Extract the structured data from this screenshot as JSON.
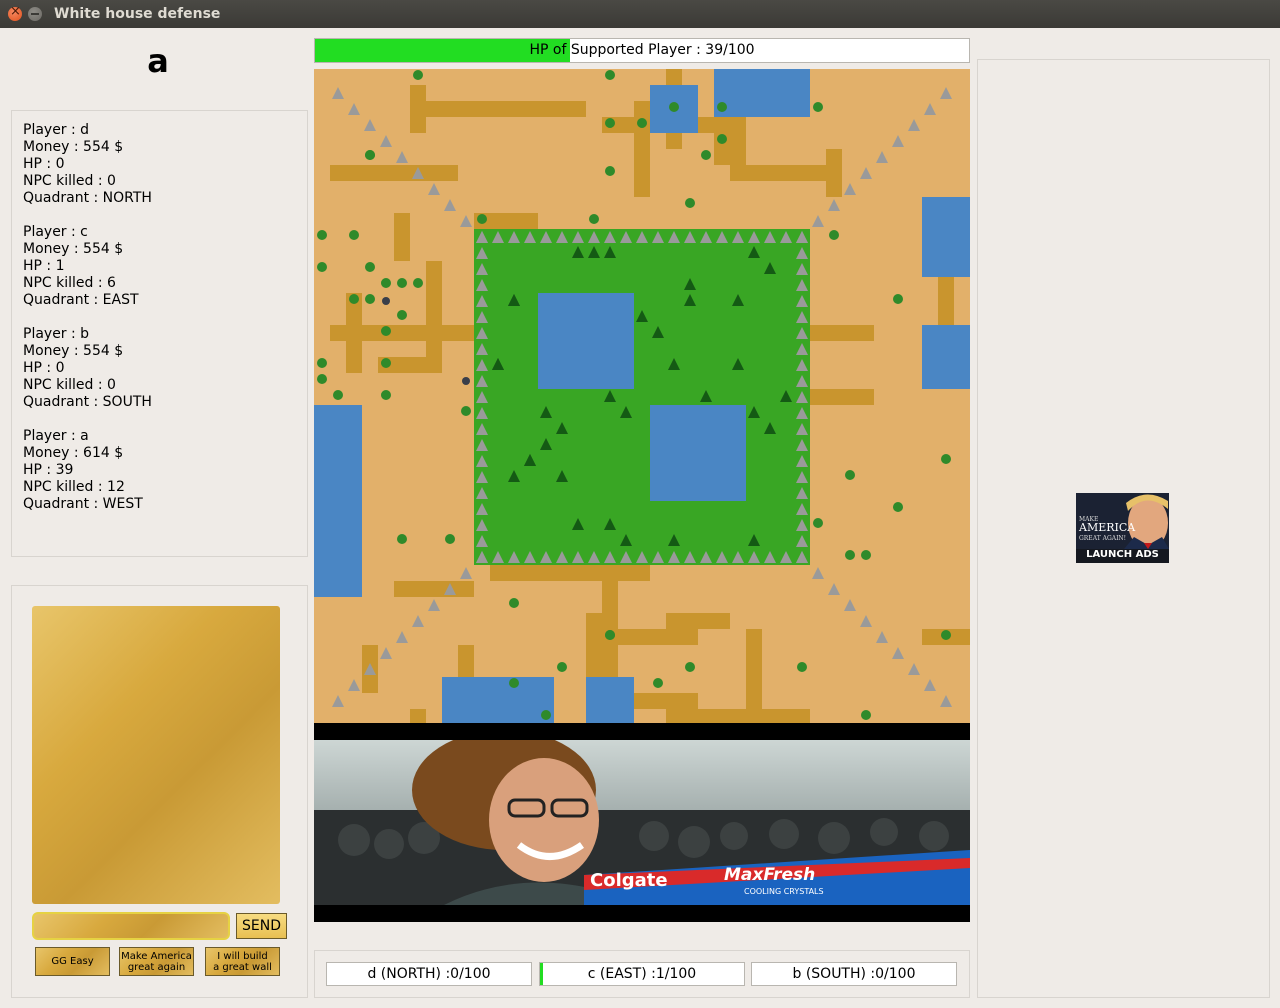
{
  "window": {
    "title": "White house defense"
  },
  "player": {
    "name": "a"
  },
  "players": [
    {
      "player": "Player : d",
      "money": "Money : 554 $",
      "hp": "HP : 0",
      "npc": "NPC killed : 0",
      "quadrant": "Quadrant : NORTH"
    },
    {
      "player": "Player : c",
      "money": "Money : 554 $",
      "hp": "HP : 1",
      "npc": "NPC killed : 6",
      "quadrant": "Quadrant : EAST"
    },
    {
      "player": "Player : b",
      "money": "Money : 554 $",
      "hp": "HP : 0",
      "npc": "NPC killed : 0",
      "quadrant": "Quadrant : SOUTH"
    },
    {
      "player": "Player : a",
      "money": "Money : 614 $",
      "hp": "HP : 39",
      "npc": "NPC killed : 12",
      "quadrant": "Quadrant : WEST"
    }
  ],
  "hp_bar": {
    "label": "HP of Supported Player : 39/100",
    "value": 39,
    "max": 100,
    "color": "#22dd22"
  },
  "chat": {
    "input_value": "",
    "send_label": "SEND",
    "quick_messages": [
      {
        "line1": "GG Easy",
        "line2": ""
      },
      {
        "line1": "Make America",
        "line2": "great again"
      },
      {
        "line1": "I will build",
        "line2": "a great wall"
      }
    ]
  },
  "ad": {
    "small1": "MAKE",
    "big": "AMERICA",
    "small2": "GREAT AGAIN!",
    "label": "LAUNCH ADS"
  },
  "video": {
    "brand": "Colgate",
    "product": "MaxFresh",
    "tagline": "COOLING CRYSTALS"
  },
  "quadrant_progress": [
    {
      "label": "d (NORTH) :0/100",
      "value": 0
    },
    {
      "label": "c (EAST) :1/100",
      "value": 1
    },
    {
      "label": "b (SOUTH) :0/100",
      "value": 0
    }
  ],
  "colors": {
    "sand": "#e2b06a",
    "path": "#c9952e",
    "water": "#4a86c4",
    "grass": "#39a624",
    "rock": "#9a9a9a",
    "accent_green": "#22dd22"
  },
  "icons": [
    "close-icon",
    "minimize-icon",
    "palm-tree-icon",
    "rock-icon",
    "pine-tree-icon",
    "npc-icon"
  ]
}
